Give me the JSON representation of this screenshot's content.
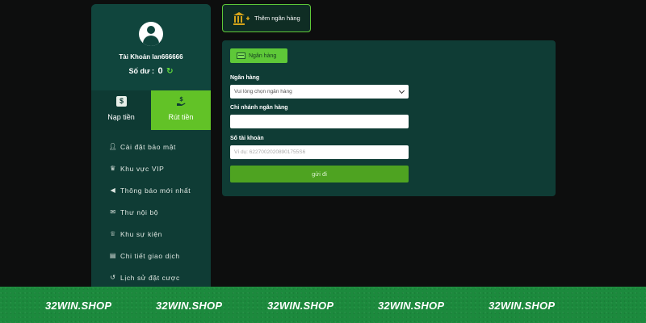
{
  "sidebar": {
    "account_label": "Tài Khoản lan666666",
    "balance_label": "Số dư :",
    "balance_value": "0",
    "tabs": [
      {
        "label": "Nạp tiền",
        "icon": "dollar-icon",
        "active": false
      },
      {
        "label": "Rút tiền",
        "icon": "hand-money-icon",
        "active": true
      }
    ],
    "menu": [
      {
        "label": "Cài đặt bảo mật",
        "icon": "user-settings-icon"
      },
      {
        "label": "Khu vực VIP",
        "icon": "crown-icon"
      },
      {
        "label": "Thông báo mới nhất",
        "icon": "megaphone-icon"
      },
      {
        "label": "Thư nội bộ",
        "icon": "mail-icon"
      },
      {
        "label": "Khu sự kiện",
        "icon": "trophy-icon"
      },
      {
        "label": "Chi tiết giao dịch",
        "icon": "clipboard-icon"
      },
      {
        "label": "Lịch sử đặt cược",
        "icon": "history-icon"
      }
    ]
  },
  "add_bank": {
    "label": "Thêm ngân hàng",
    "icon": "bank-plus-icon"
  },
  "form": {
    "section_label": "Ngân hàng",
    "bank_label": "Ngân hàng",
    "bank_select_value": "Vui lòng chọn ngân hàng",
    "branch_label": "Chi nhánh ngân hàng",
    "branch_value": "",
    "account_label": "Số tài khoản",
    "account_placeholder": "Ví dụ: 62270020208901755S6",
    "submit_label": "gửi đi"
  },
  "footer": {
    "watermarks": [
      "32WIN.SHOP",
      "32WIN.SHOP",
      "32WIN.SHOP",
      "32WIN.SHOP",
      "32WIN.SHOP"
    ]
  },
  "colors": {
    "accent": "#5ec838",
    "panel": "#0f3c35",
    "background": "#0d0e0e",
    "footer": "#1c8a3d"
  }
}
